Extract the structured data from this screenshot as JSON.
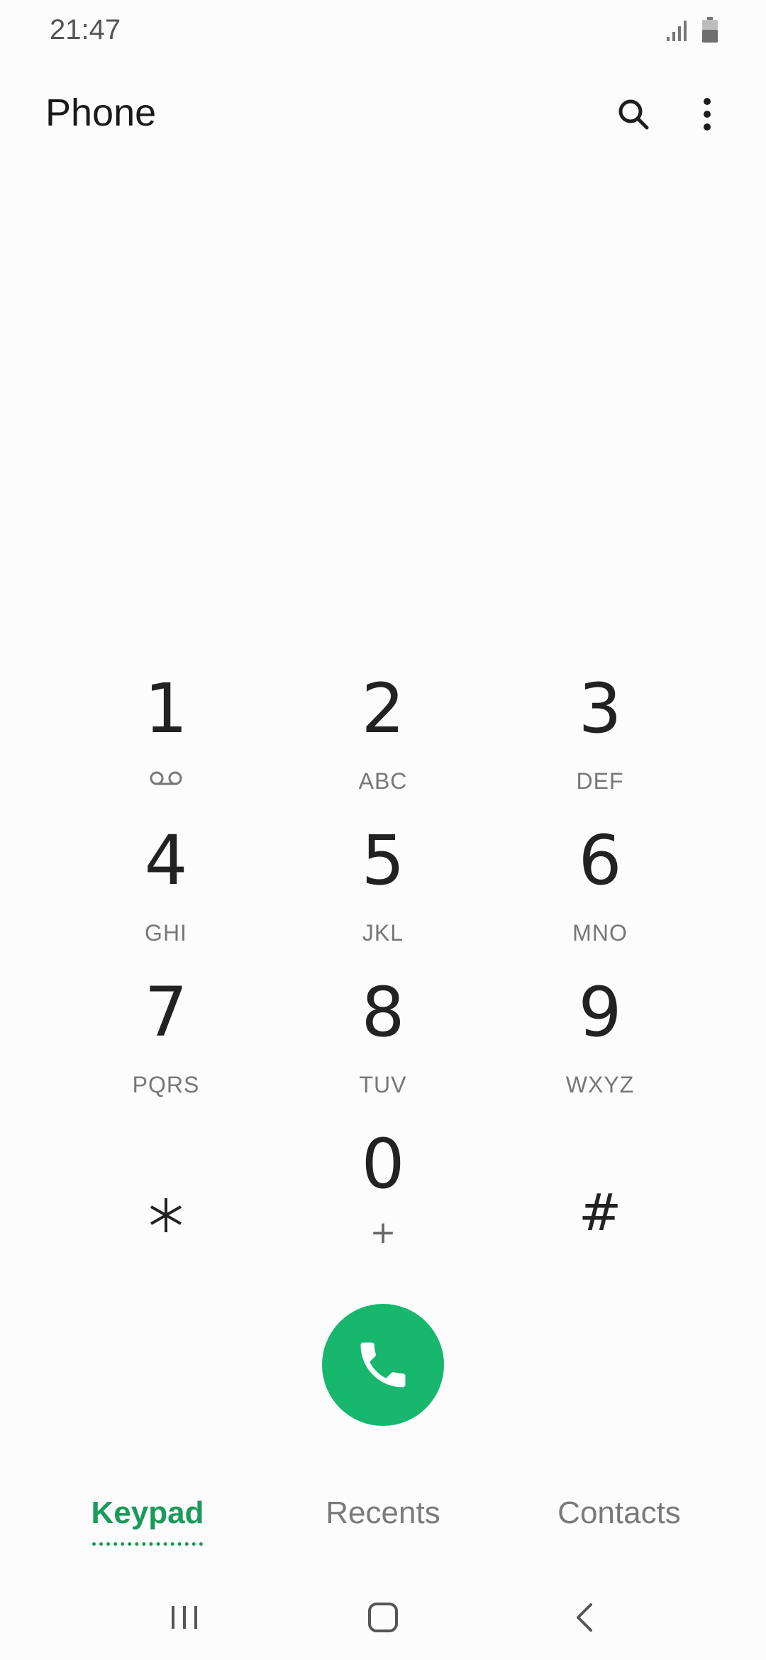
{
  "status_bar": {
    "time": "21:47",
    "icons": [
      "signal-icon",
      "battery-icon"
    ]
  },
  "header": {
    "title": "Phone",
    "actions": [
      "search-icon",
      "more-options-icon"
    ]
  },
  "keypad": {
    "keys": [
      {
        "digit": "1",
        "letters": "",
        "icon": "voicemail-icon"
      },
      {
        "digit": "2",
        "letters": "ABC"
      },
      {
        "digit": "3",
        "letters": "DEF"
      },
      {
        "digit": "4",
        "letters": "GHI"
      },
      {
        "digit": "5",
        "letters": "JKL"
      },
      {
        "digit": "6",
        "letters": "MNO"
      },
      {
        "digit": "7",
        "letters": "PQRS"
      },
      {
        "digit": "8",
        "letters": "TUV"
      },
      {
        "digit": "9",
        "letters": "WXYZ"
      },
      {
        "digit": "*",
        "letters": "",
        "icon": "asterisk-icon"
      },
      {
        "digit": "0",
        "letters": "+"
      },
      {
        "digit": "#",
        "letters": ""
      }
    ]
  },
  "call_button": {
    "icon": "phone-handset-icon",
    "color": "#17b76d"
  },
  "tabs": [
    {
      "label": "Keypad",
      "active": true
    },
    {
      "label": "Recents",
      "active": false
    },
    {
      "label": "Contacts",
      "active": false
    }
  ],
  "nav_bar": {
    "icons": [
      "recent-apps-icon",
      "home-icon",
      "back-icon"
    ]
  },
  "colors": {
    "accent": "#1a9a5c",
    "call_green": "#17b76d",
    "text": "#222222",
    "secondary_text": "#777777",
    "background": "#fcfcfc"
  }
}
